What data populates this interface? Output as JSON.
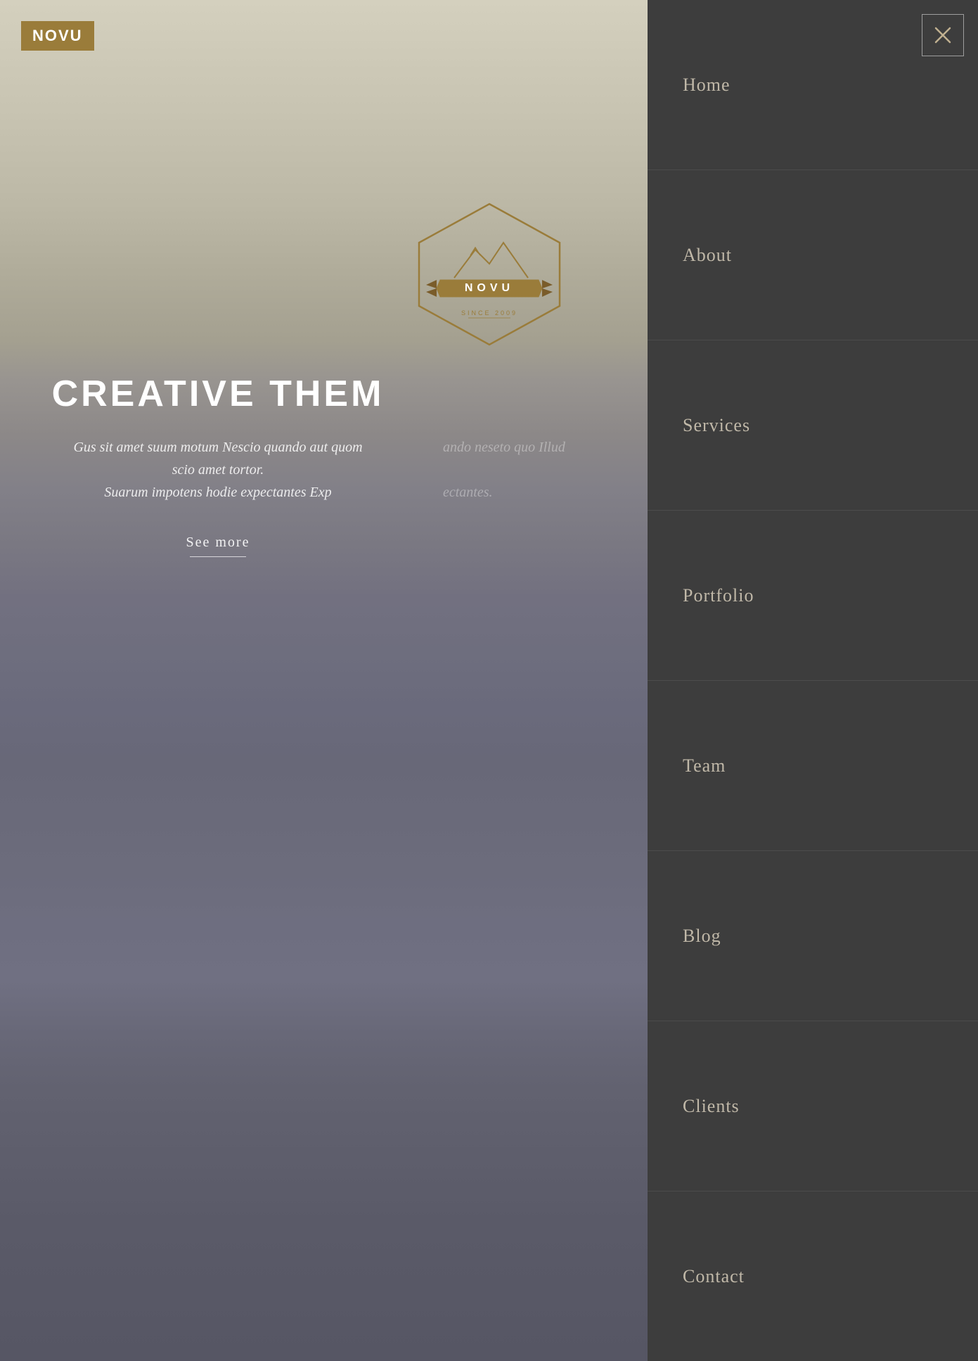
{
  "logo": {
    "text": "NOVU"
  },
  "badge": {
    "brand": "NOVU",
    "tagline": "SINCE 2009",
    "color": "#9a7c3a"
  },
  "hero": {
    "title": "CREATIVE THEM",
    "subtitle_line1": "Gus sit amet suum motum Nescio quando aut quom",
    "subtitle_line2": "ando neseto quo Illud",
    "subtitle_line3": "scio amet tortor.",
    "subtitle_line4": "Suarum impotens hodie expectantes Exp",
    "subtitle_line5": "ectantes.",
    "see_more": "See more"
  },
  "nav": {
    "items": [
      {
        "label": "Home",
        "id": "home"
      },
      {
        "label": "About",
        "id": "about"
      },
      {
        "label": "Services",
        "id": "services"
      },
      {
        "label": "Portfolio",
        "id": "portfolio"
      },
      {
        "label": "Team",
        "id": "team"
      },
      {
        "label": "Blog",
        "id": "blog"
      },
      {
        "label": "Clients",
        "id": "clients"
      },
      {
        "label": "Contact",
        "id": "contact"
      }
    ],
    "close_label": "×"
  },
  "colors": {
    "gold": "#9a7c3a",
    "nav_bg": "#3d3d3d",
    "nav_text": "#c0b8a8",
    "close_border": "rgba(255,255,255,0.5)"
  }
}
